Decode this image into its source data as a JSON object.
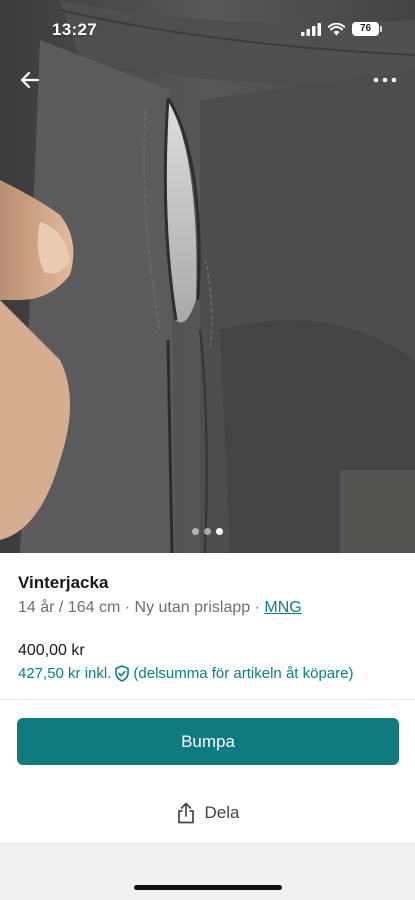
{
  "status_bar": {
    "time": "13:27",
    "battery": "76"
  },
  "nav": {
    "back_icon": "arrow-left-icon",
    "more_icon": "more-horizontal-icon"
  },
  "gallery": {
    "total_images": 3,
    "current_index": 3
  },
  "item": {
    "title": "Vinterjacka",
    "size": "14 år / 164 cm",
    "condition": "Ny utan prislapp",
    "separator": "·",
    "brand": "MNG",
    "price": "400,00 kr",
    "price_incl": "427,50 kr inkl.",
    "buyer_protection_note": "(delsumma för artikeln åt köpare)"
  },
  "actions": {
    "bump_label": "Bumpa",
    "share_label": "Dela"
  },
  "colors": {
    "accent": "#0f7a80",
    "link": "#0a7f86",
    "text": "#1a1a1a",
    "muted": "#6f6f6f"
  }
}
